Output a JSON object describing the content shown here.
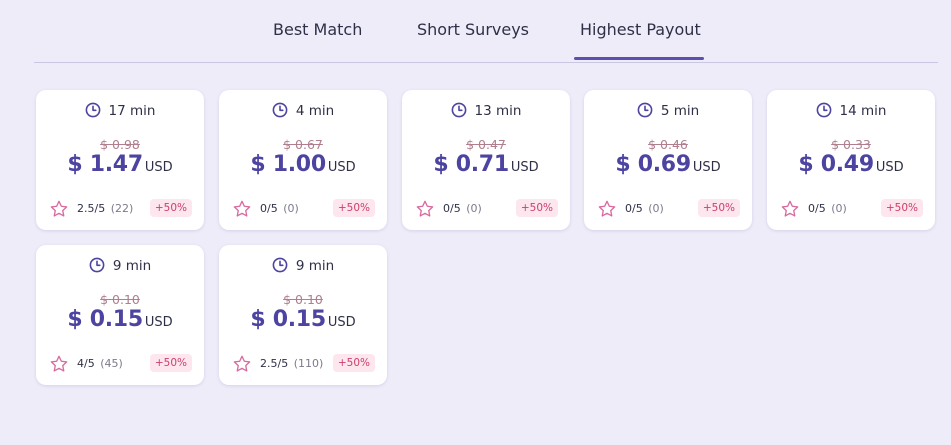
{
  "tabs": [
    {
      "label": "Best Match",
      "active": false
    },
    {
      "label": "Short Surveys",
      "active": false
    },
    {
      "label": "Highest Payout",
      "active": true
    }
  ],
  "accent_color": "#5b4fb0",
  "surveys": [
    {
      "time": "17 min",
      "old_price": "$ 0.98",
      "price": "$ 1.47",
      "currency": "USD",
      "rating": "2.5/5",
      "count": "(22)",
      "bonus": "+50%"
    },
    {
      "time": "4 min",
      "old_price": "$ 0.67",
      "price": "$ 1.00",
      "currency": "USD",
      "rating": "0/5",
      "count": "(0)",
      "bonus": "+50%"
    },
    {
      "time": "13 min",
      "old_price": "$ 0.47",
      "price": "$ 0.71",
      "currency": "USD",
      "rating": "0/5",
      "count": "(0)",
      "bonus": "+50%"
    },
    {
      "time": "5 min",
      "old_price": "$ 0.46",
      "price": "$ 0.69",
      "currency": "USD",
      "rating": "0/5",
      "count": "(0)",
      "bonus": "+50%"
    },
    {
      "time": "14 min",
      "old_price": "$ 0.33",
      "price": "$ 0.49",
      "currency": "USD",
      "rating": "0/5",
      "count": "(0)",
      "bonus": "+50%"
    },
    {
      "time": "9 min",
      "old_price": "$ 0.10",
      "price": "$ 0.15",
      "currency": "USD",
      "rating": "4/5",
      "count": "(45)",
      "bonus": "+50%"
    },
    {
      "time": "9 min",
      "old_price": "$ 0.10",
      "price": "$ 0.15",
      "currency": "USD",
      "rating": "2.5/5",
      "count": "(110)",
      "bonus": "+50%"
    }
  ]
}
